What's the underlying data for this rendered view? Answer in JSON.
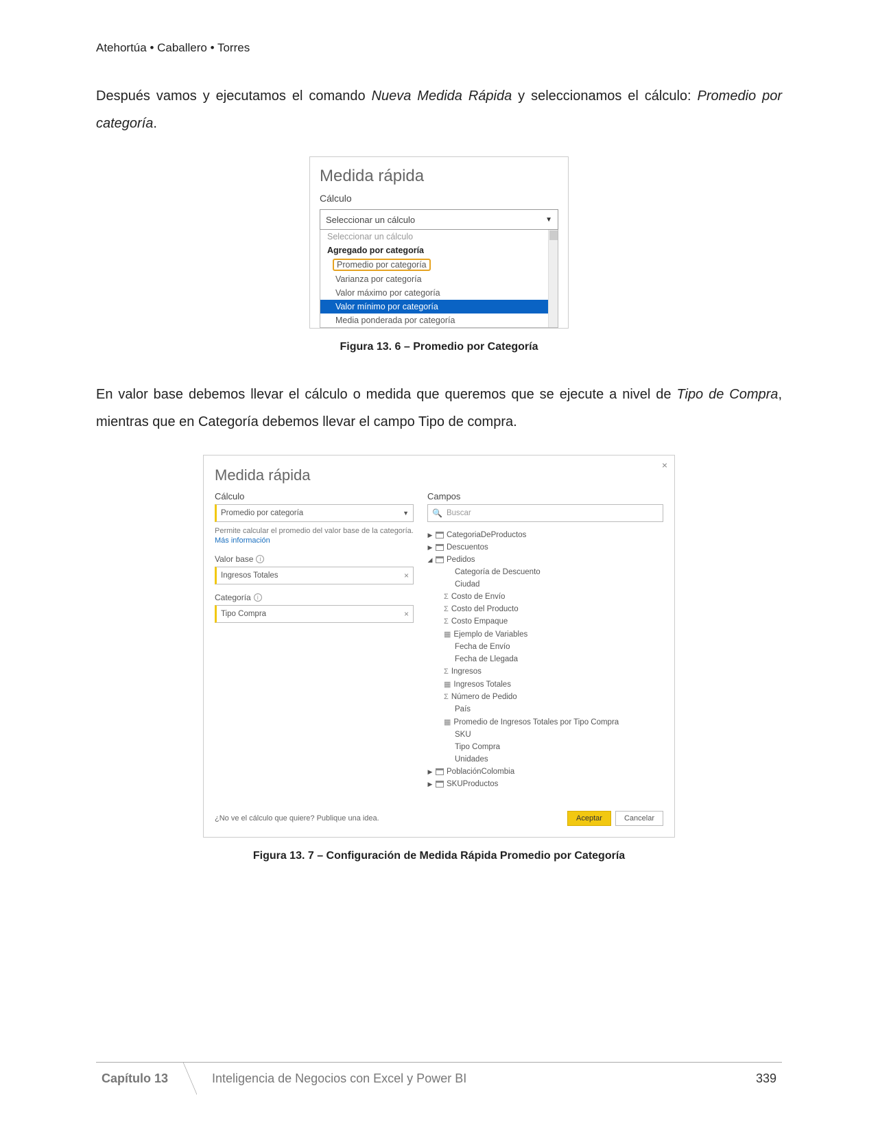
{
  "authors": "Atehortúa • Caballero • Torres",
  "para1_a": "Después vamos y ejecutamos el comando ",
  "para1_em1": "Nueva Medida Rápida",
  "para1_b": " y seleccionamos el cálculo: ",
  "para1_em2": "Promedio por categoría",
  "para1_c": ".",
  "fig6": {
    "title": "Medida rápida",
    "lbl": "Cálculo",
    "combo": "Seleccionar un cálculo",
    "it_ghost": "Seleccionar un cálculo",
    "it_head": "Agregado por categoría",
    "it_prom": "Promedio por categoría",
    "it_var": "Varianza por categoría",
    "it_max": "Valor máximo por categoría",
    "it_min": "Valor mínimo por categoría",
    "it_med": "Media ponderada por categoría",
    "caption": "Figura 13. 6 – Promedio por Categoría"
  },
  "para2_a": "En valor base debemos llevar el cálculo o medida que queremos que se ejecute a nivel de ",
  "para2_em1": "Tipo de Compra",
  "para2_b": ", mientras que en Categoría debemos llevar el campo Tipo de compra.",
  "fig7": {
    "title": "Medida rápida",
    "lbl_calc": "Cálculo",
    "fld_calc": "Promedio por categoría",
    "desc1": "Permite calcular el promedio del valor base de la categoría. ",
    "desc_link": "Más información",
    "lbl_vb": "Valor base",
    "fld_vb": "Ingresos Totales",
    "lbl_cat": "Categoría",
    "fld_cat": "Tipo Compra",
    "lbl_campos": "Campos",
    "search_ph": "Buscar",
    "tree": {
      "t1": "CategoriaDeProductos",
      "t2": "Descuentos",
      "t3": "Pedidos",
      "c_catdesc": "Categoría de Descuento",
      "c_ciudad": "Ciudad",
      "c_ce": "Costo de Envío",
      "c_cp": "Costo del Producto",
      "c_cemp": "Costo Empaque",
      "c_ev": "Ejemplo de Variables",
      "c_fe": "Fecha de Envío",
      "c_fl": "Fecha de Llegada",
      "c_ing": "Ingresos",
      "c_it": "Ingresos Totales",
      "c_np": "Número de Pedido",
      "c_pais": "País",
      "c_pit": "Promedio de Ingresos Totales por Tipo Compra",
      "c_sku": "SKU",
      "c_tc": "Tipo Compra",
      "c_un": "Unidades",
      "t4": "PoblaciónColombia",
      "t5": "SKUProductos"
    },
    "foot_q": "¿No ve el cálculo que quiere? Publique una idea.",
    "btn_ok": "Aceptar",
    "btn_cancel": "Cancelar",
    "caption": "Figura 13. 7 – Configuración de Medida Rápida Promedio por Categoría"
  },
  "footer": {
    "chap": "Capítulo 13",
    "title": "Inteligencia de Negocios con Excel y Power BI",
    "page": "339"
  }
}
